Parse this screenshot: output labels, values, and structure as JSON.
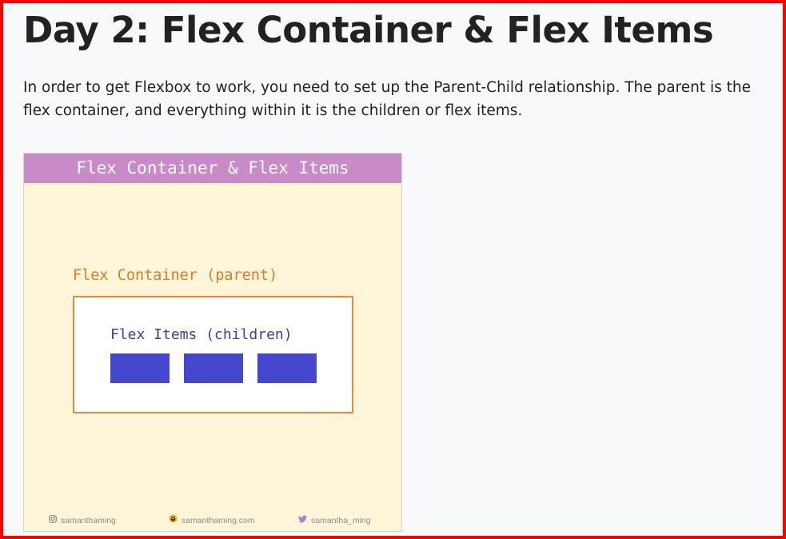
{
  "page": {
    "title": "Day 2: Flex Container & Flex Items",
    "intro": "In order to get Flexbox to work, you need to set up the Parent-Child relationship. The parent is the flex container, and everything within it is the children or flex items."
  },
  "figure": {
    "header": "Flex Container & Flex Items",
    "container_label": "Flex Container (parent)",
    "items_label": "Flex Items (children)",
    "item_count": 3,
    "colors": {
      "header_bg": "#c98ac8",
      "figure_bg": "#fff6da",
      "container_border": "#e88a3c",
      "container_label": "#e07c22",
      "items_label": "#3b3fa0",
      "item_fill": "#4348cf"
    },
    "footer": {
      "instagram": {
        "icon": "instagram-icon",
        "text": "samanthaming"
      },
      "website": {
        "icon": "website-logo-icon",
        "text": "samanthaming.com"
      },
      "twitter": {
        "icon": "twitter-bird-icon",
        "text": "samantha_ming"
      }
    }
  },
  "colors": {
    "frame_border": "#ff0000",
    "page_bg": "#f8f9fb"
  }
}
